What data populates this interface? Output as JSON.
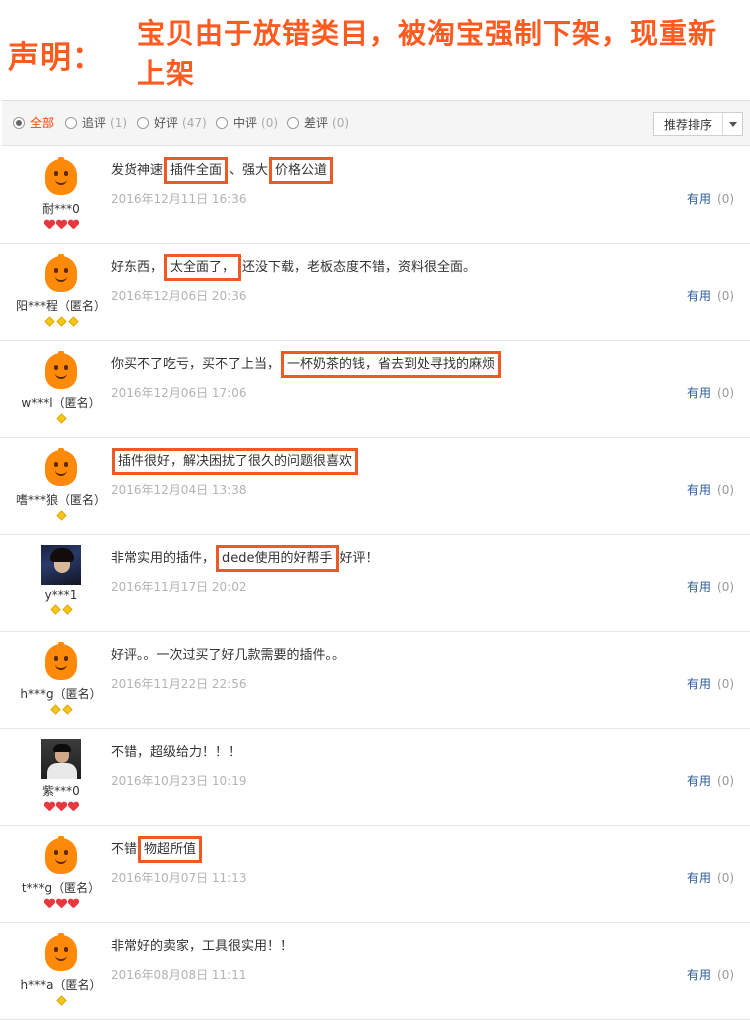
{
  "notice": {
    "label": "声明：",
    "text": "宝贝由于放错类目，被淘宝强制下架，现重新上架"
  },
  "filters": [
    {
      "label": "全部",
      "count": "",
      "checked": true
    },
    {
      "label": "追评",
      "count": "(1)",
      "checked": false
    },
    {
      "label": "好评",
      "count": "(47)",
      "checked": false
    },
    {
      "label": "中评",
      "count": "(0)",
      "checked": false
    },
    {
      "label": "差评",
      "count": "(0)",
      "checked": false
    }
  ],
  "sort": {
    "label": "推荐排序"
  },
  "useful_label": "有用",
  "reviews": [
    {
      "user": "耐***0",
      "avatar": "default-avatar",
      "badge": "heart",
      "badge_count": 3,
      "segments": [
        {
          "t": "发货神速"
        },
        {
          "t": "插件全面",
          "hl": true
        },
        {
          "t": "、强大"
        },
        {
          "t": "价格公道",
          "hl": true
        }
      ],
      "date": "2016年12月11日 16:36",
      "useful_count": "(0)"
    },
    {
      "user": "阳***程（匿名）",
      "avatar": "default-avatar",
      "badge": "diamond",
      "badge_count": 3,
      "segments": [
        {
          "t": "好东西，"
        },
        {
          "t": "太全面了，",
          "hl": true
        },
        {
          "t": "还没下载，老板态度不错，资料很全面。"
        }
      ],
      "date": "2016年12月06日 20:36",
      "useful_count": "(0)"
    },
    {
      "user": "w***l（匿名）",
      "avatar": "default-avatar",
      "badge": "diamond",
      "badge_count": 1,
      "segments": [
        {
          "t": "你买不了吃亏，买不了上当，"
        },
        {
          "t": "一杯奶茶的钱，省去到处寻找的麻烦",
          "hl": true
        }
      ],
      "date": "2016年12月06日 17:06",
      "useful_count": "(0)"
    },
    {
      "user": "嗜***狼（匿名）",
      "avatar": "default-avatar",
      "badge": "diamond",
      "badge_count": 1,
      "segments": [
        {
          "t": "插件很好，解决困扰了很久的问题很喜欢",
          "hl": true
        }
      ],
      "date": "2016年12月04日 13:38",
      "useful_count": "(0)"
    },
    {
      "user": "y***1",
      "avatar": "user-photo",
      "badge": "diamond",
      "badge_count": 2,
      "segments": [
        {
          "t": "非常实用的插件，"
        },
        {
          "t": "dede使用的好帮手",
          "hl": true
        },
        {
          "t": "好评！"
        }
      ],
      "date": "2016年11月17日 20:02",
      "useful_count": "(0)"
    },
    {
      "user": "h***g（匿名）",
      "avatar": "default-avatar",
      "badge": "diamond",
      "badge_count": 2,
      "segments": [
        {
          "t": "好评。。一次过买了好几款需要的插件。。"
        }
      ],
      "date": "2016年11月22日 22:56",
      "useful_count": "(0)"
    },
    {
      "user": "紫***0",
      "avatar": "user-photo-2",
      "badge": "heart",
      "badge_count": 3,
      "segments": [
        {
          "t": "不错，超级给力！！！"
        }
      ],
      "date": "2016年10月23日 10:19",
      "useful_count": "(0)"
    },
    {
      "user": "t***g（匿名）",
      "avatar": "default-avatar",
      "badge": "heart",
      "badge_count": 3,
      "segments": [
        {
          "t": "不错"
        },
        {
          "t": "物超所值",
          "hl": true
        }
      ],
      "date": "2016年10月07日 11:13",
      "useful_count": "(0)"
    },
    {
      "user": "h***a（匿名）",
      "avatar": "default-avatar",
      "badge": "diamond",
      "badge_count": 1,
      "segments": [
        {
          "t": "非常好的卖家，工具很实用！！"
        }
      ],
      "date": "2016年08月08日 11:11",
      "useful_count": "(0)"
    }
  ]
}
